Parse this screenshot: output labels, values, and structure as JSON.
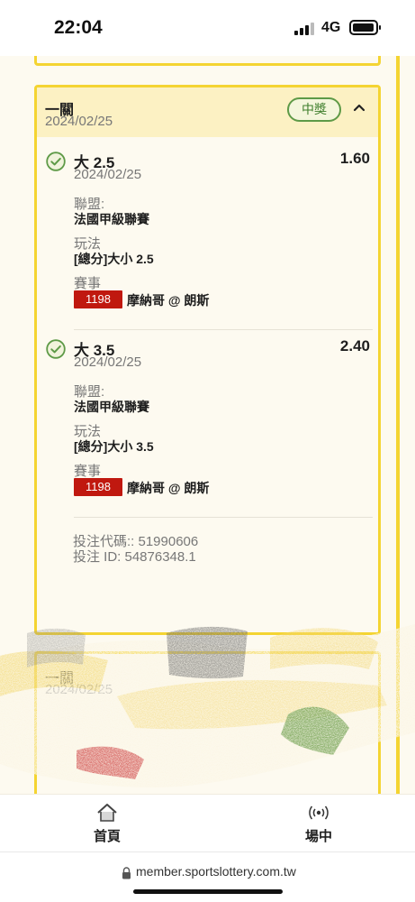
{
  "status_bar": {
    "time": "22:04",
    "network": "4G"
  },
  "card": {
    "title": "一關",
    "date": "2024/02/25",
    "status_badge": "中獎",
    "chevron": "⌃",
    "bets": [
      {
        "name": "大 2.5",
        "date": "2024/02/25",
        "odds": "1.60",
        "league_label": "聯盟:",
        "league": "法國甲級聯賽",
        "playtype_label": "玩法",
        "playtype": "[總分]大小 2.5",
        "match_label": "賽事",
        "match_no": "1198",
        "match": "摩納哥 @ 朗斯"
      },
      {
        "name": "大 3.5",
        "date": "2024/02/25",
        "odds": "2.40",
        "league_label": "聯盟:",
        "league": "法國甲級聯賽",
        "playtype_label": "玩法",
        "playtype": "[總分]大小 3.5",
        "match_label": "賽事",
        "match_no": "1198",
        "match": "摩納哥 @ 朗斯"
      }
    ],
    "bet_code": "投注代碼:: 51990606",
    "bet_id": "投注 ID: 54876348.1"
  },
  "next_card": {
    "title": "一關",
    "date": "2024/02/25"
  },
  "bottom_nav": {
    "items": [
      {
        "label": "首頁",
        "icon": "home-icon"
      },
      {
        "label": "場中",
        "icon": "live-broadcast-icon"
      }
    ]
  },
  "browser": {
    "url": "member.sportslottery.com.tw"
  },
  "colors": {
    "accent_yellow": "#f4d432",
    "win_green": "#5e9a47",
    "match_red": "#c0180f"
  }
}
